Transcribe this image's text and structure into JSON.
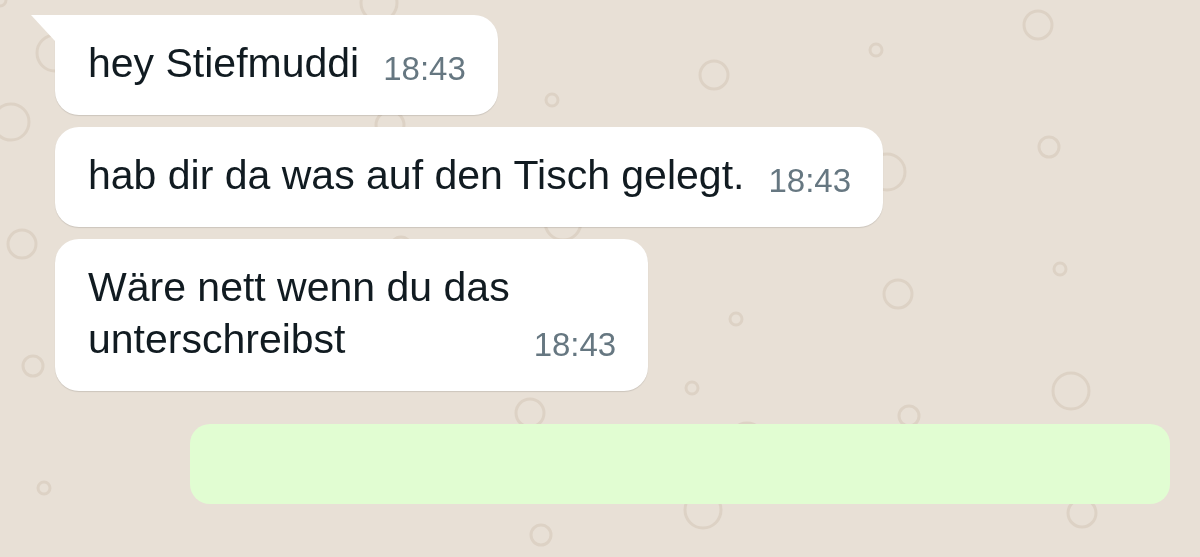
{
  "messages": [
    {
      "kind": "incoming",
      "tail": true,
      "lines": [
        "hey Stiefmuddi"
      ],
      "time": "18:43"
    },
    {
      "kind": "incoming",
      "tail": false,
      "lines": [
        "hab dir da was auf den Tisch gelegt."
      ],
      "time": "18:43"
    },
    {
      "kind": "incoming",
      "tail": false,
      "lines": [
        "Wäre nett wenn du das",
        "unterschreibst"
      ],
      "time": "18:43"
    },
    {
      "kind": "outgoing",
      "tail": false
    }
  ]
}
